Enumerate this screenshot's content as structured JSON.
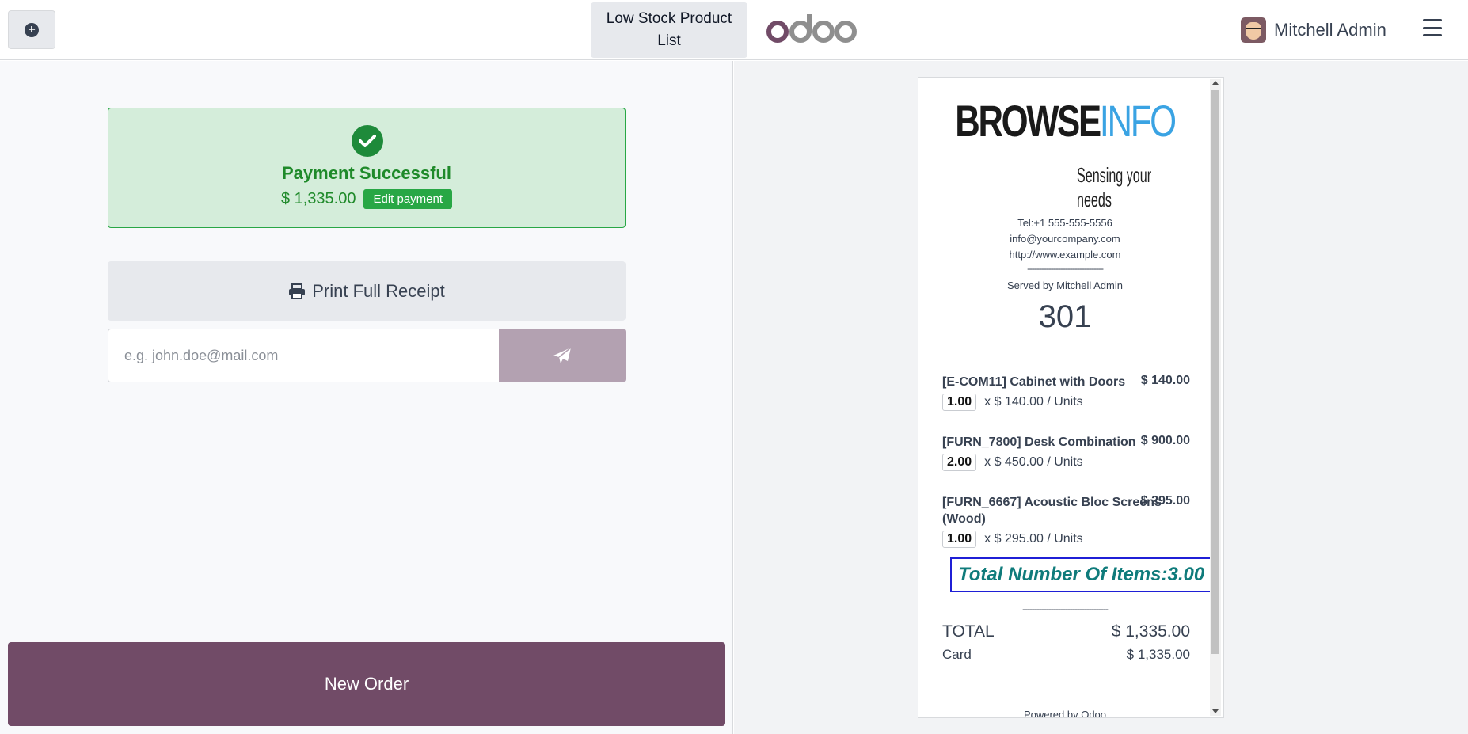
{
  "topbar": {
    "plus_icon": "plus-circle-icon",
    "low_stock_label": "Low Stock Product List",
    "logo_text": "odoo",
    "user_name": "Mitchell Admin",
    "menu_icon": "hamburger-icon"
  },
  "payment": {
    "status": "Payment Successful",
    "amount": "$ 1,335.00",
    "edit_label": "Edit payment",
    "print_label": "Print Full Receipt",
    "email_placeholder": "e.g. john.doe@mail.com",
    "new_order_label": "New Order"
  },
  "receipt": {
    "brand_part1": "BROWSE",
    "brand_part2": "INFO",
    "tagline": "Sensing your needs",
    "phone": "Tel:+1 555-555-5556",
    "email": "info@yourcompany.com",
    "website": "http://www.example.com",
    "separator": "--------------------------------",
    "served_by": "Served by Mitchell Admin",
    "order_number": "301",
    "items": [
      {
        "name": "[E-COM11] Cabinet with Doors",
        "price": "$ 140.00",
        "qty": "1.00",
        "unit_price": "x $ 140.00 / Units"
      },
      {
        "name": "[FURN_7800] Desk Combination",
        "price": "$ 900.00",
        "qty": "2.00",
        "unit_price": "x $ 450.00 / Units"
      },
      {
        "name": "[FURN_6667] Acoustic Bloc Screens (Wood)",
        "price": "$ 295.00",
        "qty": "1.00",
        "unit_price": "x $ 295.00 / Units"
      }
    ],
    "total_items": "Total Number Of Items:3.00",
    "separator2": "------------------------------------",
    "total_label": "TOTAL",
    "total_value": "$ 1,335.00",
    "card_label": "Card",
    "card_value": "$ 1,335.00",
    "powered_by": "Powered by Odoo"
  },
  "colors": {
    "brand_primary": "#714b67",
    "success": "#28a745",
    "total_items_border": "#1f1fd6",
    "total_items_text": "#0f7b7b"
  }
}
